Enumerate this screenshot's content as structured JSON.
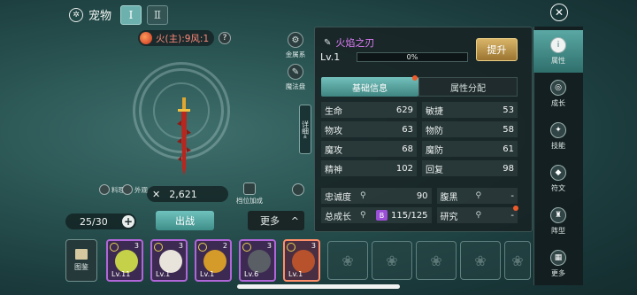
{
  "header": {
    "title": "宠物",
    "tab_1": "Ⅰ",
    "tab_2": "Ⅱ",
    "close": "✕"
  },
  "pet": {
    "element_label": "火(主):9风:1",
    "help": "?",
    "side_actions": [
      {
        "label": "金属系",
        "icon": "gear-icon"
      },
      {
        "label": "魔法盘",
        "icon": "scroll-icon"
      }
    ],
    "detail_tab": "详细",
    "detail_chevron": "«",
    "feed_label": "料理",
    "appearance_label": "外观",
    "power_value": "2,621",
    "slot_bonus_label": "档位加成",
    "count": "25/30",
    "plus": "+",
    "deploy_label": "出战",
    "more_label": "更多",
    "more_chevron": "^"
  },
  "pet_bar": {
    "guide_label": "图鉴",
    "cards": [
      {
        "lv": "Lv.11",
        "star": "3",
        "color": "#c6d14a"
      },
      {
        "lv": "Lv.1",
        "star": "3",
        "color": "#e8e4dc"
      },
      {
        "lv": "Lv.1",
        "star": "2",
        "color": "#d49a2a"
      },
      {
        "lv": "Lv.6",
        "star": "3",
        "color": "#5a5f66"
      },
      {
        "lv": "Lv.1",
        "star": "3",
        "color": "#b8522c"
      }
    ],
    "empty_slot_icon": "paw-icon"
  },
  "weapon": {
    "name": "火焰之刃",
    "level": "Lv.1",
    "xp_percent": "0%",
    "upgrade_label": "提升",
    "tab_basic": "基础信息",
    "tab_attr": "属性分配",
    "stats": [
      {
        "k": "生命",
        "v": "629"
      },
      {
        "k": "敏捷",
        "v": "53"
      },
      {
        "k": "物攻",
        "v": "63"
      },
      {
        "k": "物防",
        "v": "58"
      },
      {
        "k": "魔攻",
        "v": "68"
      },
      {
        "k": "魔防",
        "v": "61"
      },
      {
        "k": "精神",
        "v": "102"
      },
      {
        "k": "回复",
        "v": "98"
      }
    ],
    "loyalty_label": "忠诚度",
    "loyalty_value": "90",
    "dark_label": "腹黑",
    "dark_value": "-",
    "growth_label": "总成长",
    "growth_grade": "B",
    "growth_value": "115/125",
    "research_label": "研究",
    "research_value": "-"
  },
  "right_nav": [
    {
      "label": "属性",
      "icon": "info-icon",
      "glyph": "i"
    },
    {
      "label": "成长",
      "icon": "swirl-icon",
      "glyph": "◎"
    },
    {
      "label": "技能",
      "icon": "skill-icon",
      "glyph": "✦"
    },
    {
      "label": "符文",
      "icon": "rune-icon",
      "glyph": "◆"
    },
    {
      "label": "阵型",
      "icon": "tower-icon",
      "glyph": "♜"
    },
    {
      "label": "更多",
      "icon": "grid-icon",
      "glyph": "▦"
    }
  ]
}
